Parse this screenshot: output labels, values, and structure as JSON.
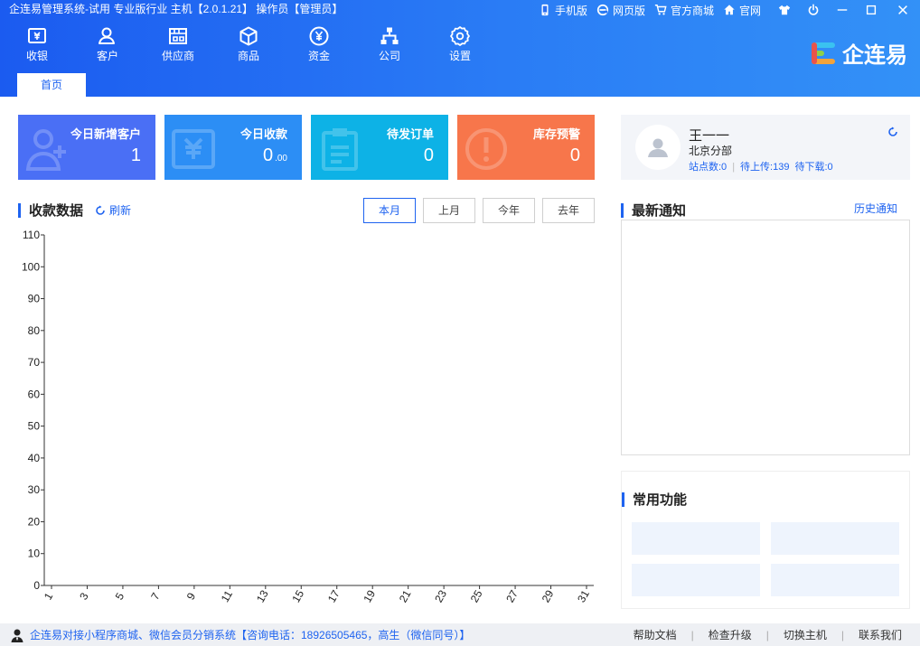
{
  "header": {
    "title": "企连易管理系统-试用 专业版行业 主机【2.0.1.21】 操作员【管理员】",
    "top_links": [
      {
        "label": "手机版",
        "icon": "mobile-icon"
      },
      {
        "label": "网页版",
        "icon": "ie-icon"
      },
      {
        "label": "官方商城",
        "icon": "cart-icon"
      },
      {
        "label": "官网",
        "icon": "home-icon"
      }
    ],
    "window_buttons": [
      "skin-icon",
      "power-icon",
      "minimize-icon",
      "maximize-icon",
      "close-icon"
    ],
    "nav": [
      {
        "label": "收银",
        "icon": "cashier-icon"
      },
      {
        "label": "客户",
        "icon": "customer-icon"
      },
      {
        "label": "供应商",
        "icon": "supplier-icon"
      },
      {
        "label": "商品",
        "icon": "product-icon"
      },
      {
        "label": "资金",
        "icon": "yuan-icon"
      },
      {
        "label": "公司",
        "icon": "org-chart-icon"
      },
      {
        "label": "设置",
        "icon": "gear-icon"
      }
    ],
    "logo_text": "企连易",
    "active_tab": "首页"
  },
  "stats": [
    {
      "label": "今日新增客户",
      "value": "1",
      "color": "#4a6ff5"
    },
    {
      "label": "今日收款",
      "value": "0",
      "decimal": ".00",
      "color": "#2c8ef5"
    },
    {
      "label": "待发订单",
      "value": "0",
      "color": "#0db2e6"
    },
    {
      "label": "库存预警",
      "value": "0",
      "color": "#f7764b"
    }
  ],
  "receipts": {
    "title": "收款数据",
    "refresh": "刷新",
    "periods": [
      "本月",
      "上月",
      "今年",
      "去年"
    ],
    "active_period": "本月"
  },
  "chart_data": {
    "type": "line",
    "x": [
      1,
      3,
      5,
      7,
      9,
      11,
      13,
      15,
      17,
      19,
      21,
      23,
      25,
      27,
      29,
      31
    ],
    "yticks": [
      0,
      10,
      20,
      30,
      40,
      50,
      60,
      70,
      80,
      90,
      100,
      110
    ],
    "ylim": [
      0,
      110
    ],
    "series": [],
    "grid": false
  },
  "profile": {
    "name": "王一一",
    "branch": "北京分部",
    "stats_text": [
      "站点数:0",
      "待上传:139",
      "待下载:0"
    ]
  },
  "notices": {
    "title": "最新通知",
    "history": "历史通知"
  },
  "common": {
    "title": "常用功能"
  },
  "footer": {
    "promo": "企连易对接小程序商城、微信会员分销系统【咨询电话：18926505465，高生（微信同号）】",
    "links": [
      "帮助文档",
      "检查升级",
      "切换主机",
      "联系我们"
    ]
  },
  "colors": {
    "primary": "#1e63f0"
  }
}
